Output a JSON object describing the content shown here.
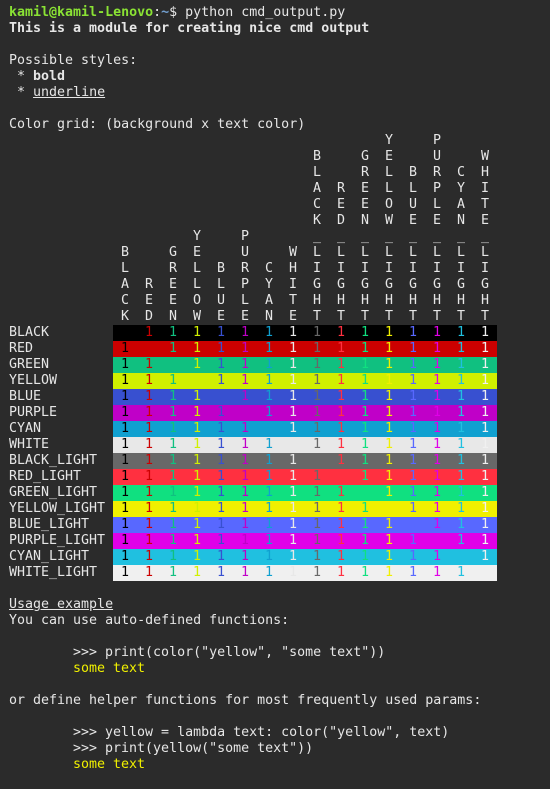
{
  "prompt": {
    "user": "kamil@kamil-Lenovo",
    "sep": ":",
    "path": "~",
    "symbol": "$",
    "command": " python cmd_output.py"
  },
  "intro": "This is a module for creating nice cmd output",
  "styles_heading": "Possible styles:",
  "style_bullet": " * ",
  "style_bold": "bold",
  "style_underline": "underline",
  "grid_heading": "Color grid: (background x text color)",
  "glyph": "1",
  "color_names": [
    "BLACK",
    "RED",
    "GREEN",
    "YELLOW",
    "BLUE",
    "PURPLE",
    "CYAN",
    "WHITE",
    "BLACK_LIGHT",
    "RED_LIGHT",
    "GREEN_LIGHT",
    "YELLOW_LIGHT",
    "BLUE_LIGHT",
    "PURPLE_LIGHT",
    "CYAN_LIGHT",
    "WHITE_LIGHT"
  ],
  "colors": {
    "BLACK": "#000000",
    "RED": "#cc0000",
    "GREEN": "#10c080",
    "YELLOW": "#d0f000",
    "BLUE": "#3850d0",
    "PURPLE": "#c000c8",
    "CYAN": "#10a0d0",
    "WHITE": "#e8e8e8",
    "BLACK_LIGHT": "#686868",
    "RED_LIGHT": "#ff3040",
    "GREEN_LIGHT": "#10e080",
    "YELLOW_LIGHT": "#f0f000",
    "BLUE_LIGHT": "#5868ff",
    "PURPLE_LIGHT": "#e000e8",
    "CYAN_LIGHT": "#20c0e0",
    "WHITE_LIGHT": "#f0f0f0"
  },
  "usage": {
    "heading": "Usage example",
    "line1": "You can use auto-defined functions:",
    "code1": ">>> print(color(\"yellow\", \"some text\"))",
    "out1": "some text",
    "line2": "or define helper functions for most frequently used params:",
    "code2a": ">>> yellow = lambda text: color(\"yellow\", text)",
    "code2b": ">>> print(yellow(\"some text\"))",
    "out2": "some text"
  }
}
